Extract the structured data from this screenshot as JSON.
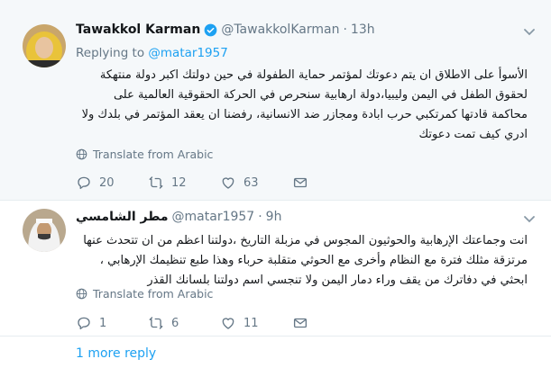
{
  "tweets": [
    {
      "name": "Tawakkol Karman",
      "handle": "@TawakkolKarman",
      "separator": "·",
      "time": "13h",
      "replying_prefix": "Replying to",
      "replying_to": "@matar1957",
      "text": "الأسوأ على الاطلاق ان يتم دعوتك لمؤتمر حماية الطفولة في حين دولتك اكبر دولة منتهكة لحقوق الطفل في اليمن وليبيا،دولة ارهابية سنحرص في الحركة الحقوقية العالمية على محاكمة قادتها كمرتكبي حرب ابادة ومجازر  ضد الانسانية، رفضنا ان يعقد المؤتمر في بلدك ولا ادري كيف تمت دعوتك",
      "translate": "Translate from Arabic",
      "replies": "20",
      "retweets": "12",
      "likes": "63"
    },
    {
      "name": "مطر الشامسي",
      "handle": "@matar1957",
      "separator": "·",
      "time": "9h",
      "text": "انت وجماعتك الإرهابية والحوثيون المجوس في مزبلة التاريخ ،دولتنا اعظم من ان تتحدث عنها مرتزقة مثلك فترة مع النظام وأخرى مع الحوثي متقلبة حرباء وهذا طبع تنظيمك الإرهابي ، ابحثي في دفاترك من يقف وراء دمار اليمن ولا تنجسي اسم دولتنا بلسانك القذر",
      "translate": "Translate from Arabic",
      "replies": "1",
      "retweets": "6",
      "likes": "11"
    }
  ],
  "more_replies": "1 more reply",
  "colors": {
    "accent": "#1da1f2",
    "muted": "#657786",
    "text": "#14171a",
    "divider": "#e6ecf0"
  },
  "icons": [
    "verified-badge-icon",
    "chevron-down-icon",
    "globe-icon",
    "reply-icon",
    "retweet-icon",
    "like-icon",
    "dm-envelope-icon"
  ]
}
